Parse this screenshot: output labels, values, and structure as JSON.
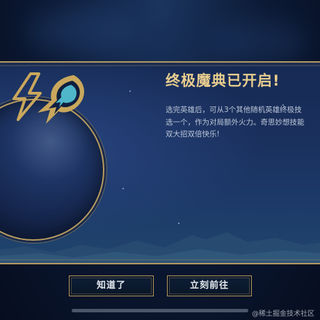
{
  "dialog": {
    "title": "终极魔典已开启!",
    "description_lines": [
      "选完英雄后，可从3个其他随机英雄终极技",
      "选一个，作为对局额外火力。奇思妙想技能",
      "双大招双倍快乐!"
    ],
    "icon": "ultimate-spellbook-icon"
  },
  "buttons": {
    "acknowledge_label": "知道了",
    "go_now_label": "立刻前往"
  },
  "watermark": "@稀土掘金技术社区",
  "colors": {
    "gold_border": "#b59a5e",
    "title_gold": "#e8cd8e",
    "icon_gold": "#c9a75c",
    "icon_cyan": "#4fb7c9",
    "panel_blue": "#1a2f5c",
    "background_navy": "#0c1a35"
  }
}
